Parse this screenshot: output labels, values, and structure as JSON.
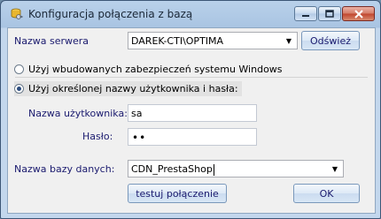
{
  "window": {
    "title": "Konfiguracja połączenia z bazą",
    "icon": "database-key-icon"
  },
  "server": {
    "label": "Nazwa serwera",
    "value": "DAREK-CTI\\OPTIMA",
    "refresh_label": "Odśwież"
  },
  "auth": {
    "option_windows": "Użyj wbudowanych zabezpieczeń systemu Windows",
    "option_custom": "Użyj określonej nazwy użytkownika i hasła:",
    "selected": "custom"
  },
  "user": {
    "label": "Nazwa użytkownika:",
    "value": "sa"
  },
  "password": {
    "label": "Hasło:",
    "masked_value": "••"
  },
  "database": {
    "label": "Nazwa bazy danych:",
    "value": "CDN_PrestaShop"
  },
  "buttons": {
    "test_label": "testuj połączenie",
    "ok_label": "OK"
  }
}
